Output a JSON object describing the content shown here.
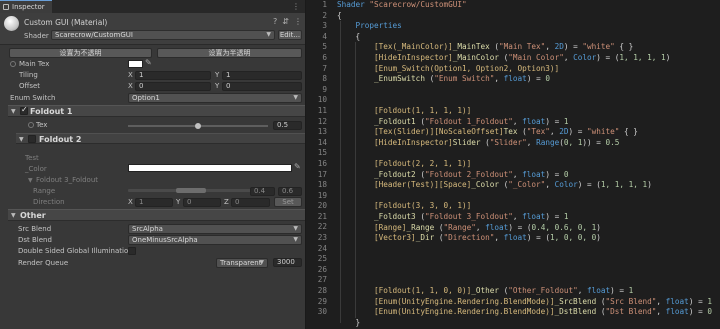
{
  "tab": {
    "title": "Inspector"
  },
  "material": {
    "name": "Custom GUI (Material)",
    "shader_label": "Shader",
    "shader_value": "Scarecrow/CustomGUI",
    "edit_label": "Edit..."
  },
  "buttons": {
    "opaque": "设置为不透明",
    "transparent": "设置为半透明"
  },
  "props": {
    "main_tex": "Main Tex",
    "tiling": "Tiling",
    "offset": "Offset",
    "tiling_x": "1",
    "tiling_y": "1",
    "offset_x": "0",
    "offset_y": "0",
    "x_label": "X",
    "y_label": "Y",
    "z_label": "Z",
    "enum_switch": "Enum Switch",
    "enum_value": "Option1"
  },
  "foldout1": {
    "title": "Foldout 1",
    "tex_label": "Tex",
    "slider_value": "0.5",
    "slider_level": 0.5
  },
  "foldout2": {
    "title": "Foldout 2",
    "header": "Test",
    "color_label": "_Color",
    "sub_title": "Foldout 3_Foldout",
    "range_label": "Range",
    "range_min": "0.4",
    "range_max": "0.6",
    "dir_label": "Direction",
    "dir_x": "1",
    "dir_y": "0",
    "dir_z": "0",
    "set_label": "Set"
  },
  "other": {
    "title": "Other",
    "src_label": "Src Blend",
    "src_value": "SrcAlpha",
    "dst_label": "Dst Blend",
    "dst_value": "OneMinusSrcAlpha",
    "dsgi_label": "Double Sided Global Illumination",
    "queue_label": "Render Queue",
    "queue_mode": "Transparent",
    "queue_value": "3000"
  },
  "code": {
    "lines": [
      "1",
      "2",
      "3",
      "4",
      "5",
      "6",
      "7",
      "8",
      "9",
      "10",
      "11",
      "12",
      "13",
      "14",
      "15",
      "16",
      "17",
      "18",
      "19",
      "20",
      "21",
      "22",
      "23",
      "24",
      "25",
      "26",
      "27",
      "28",
      "29",
      "30"
    ],
    "shader": "\"Scarecrow/CustomGUI\"",
    "l5a": "[Tex(_MainColor)]",
    "l5b": "_MainTex",
    "l5c": " (",
    "l5d": "\"Main Tex\"",
    "l5e": ", ",
    "l5f": "2D",
    "l5g": ") = ",
    "l5h": "\"white\"",
    "l5i": " { }",
    "l6a": "[HideInInspector]",
    "l6b": "_MainColor",
    "l6c": " (",
    "l6d": "\"Main Color\"",
    "l6e": ", ",
    "l6f": "Color",
    "l6g": ") = (",
    "l6h": "1, 1, 1, 1",
    "l6i": ")",
    "l7a": "[Enum_Switch(Option1, Option2, Option3)]",
    "l8a": "_EnumSwitch",
    "l8b": " (",
    "l8c": "\"Enum Switch\"",
    "l8d": ", ",
    "l8e": "float",
    "l8f": ") = ",
    "l8g": "0",
    "l10a": "[Foldout(1, 1, 1, 1)]",
    "l11a": "_Foldout1",
    "l11b": " (",
    "l11c": "\"Foldout 1_Foldout\"",
    "l11d": ", ",
    "l11e": "float",
    "l11f": ") = ",
    "l11g": "1",
    "l12a": "[Tex(Slider)][NoScaleOffset]",
    "l12b": "Tex",
    "l12c": " (",
    "l12d": "\"Tex\"",
    "l12e": ", ",
    "l12f": "2D",
    "l12g": ") = ",
    "l12h": "\"white\"",
    "l12i": " { }",
    "l13a": "[HideInInspector]",
    "l13b": "Slider",
    "l13c": " (",
    "l13d": "\"Slider\"",
    "l13e": ", ",
    "l13f": "Range",
    "l13g": "(",
    "l13h": "0, 1",
    "l13i": ")) = ",
    "l13j": "0.5",
    "l15a": "[Foldout(2, 2, 1, 1)]",
    "l16a": "_Foldout2",
    "l16b": " (",
    "l16c": "\"Foldout 2_Foldout\"",
    "l16d": ", ",
    "l16e": "float",
    "l16f": ") = ",
    "l16g": "0",
    "l17a": "[Header(Test)][Space]",
    "l17b": "_Color",
    "l17c": " (",
    "l17d": "\"_Color\"",
    "l17e": ", ",
    "l17f": "Color",
    "l17g": ") = (",
    "l17h": "1, 1, 1, 1",
    "l17i": ")",
    "l19a": "[Foldout(3, 3, 0, 1)]",
    "l20a": "_Foldout3",
    "l20b": " (",
    "l20c": "\"Foldout 3_Foldout\"",
    "l20d": ", ",
    "l20e": "float",
    "l20f": ") = ",
    "l20g": "1",
    "l21a": "[Range]",
    "l21b": "_Range",
    "l21c": " (",
    "l21d": "\"Range\"",
    "l21e": ", ",
    "l21f": "float",
    "l21g": ") = (",
    "l21h": "0.4, 0.6, 0, 1",
    "l21i": ")",
    "l22a": "[Vector3]",
    "l22b": "_Dir",
    "l22c": " (",
    "l22d": "\"Direction\"",
    "l22e": ", ",
    "l22f": "float",
    "l22g": ") = (",
    "l22h": "1, 0, 0, 0",
    "l22i": ")",
    "l27a": "[Foldout(1, 1, 0, 0)]",
    "l27b": "_Other",
    "l27c": " (",
    "l27d": "\"Other_Foldout\"",
    "l27e": ", ",
    "l27f": "float",
    "l27g": ") = ",
    "l27h": "1",
    "l28a": "[Enum(UnityEngine.Rendering.BlendMode)]",
    "l28b": "_SrcBlend",
    "l28c": " (",
    "l28d": "\"Src Blend\"",
    "l28e": ", ",
    "l28f": "float",
    "l28g": ") = ",
    "l28h": "1",
    "l29a": "[Enum(UnityEngine.Rendering.BlendMode)]",
    "l29b": "_DstBlend",
    "l29c": " (",
    "l29d": "\"Dst Blend\"",
    "l29e": ", ",
    "l29f": "float",
    "l29g": ") = ",
    "l29h": "0"
  }
}
